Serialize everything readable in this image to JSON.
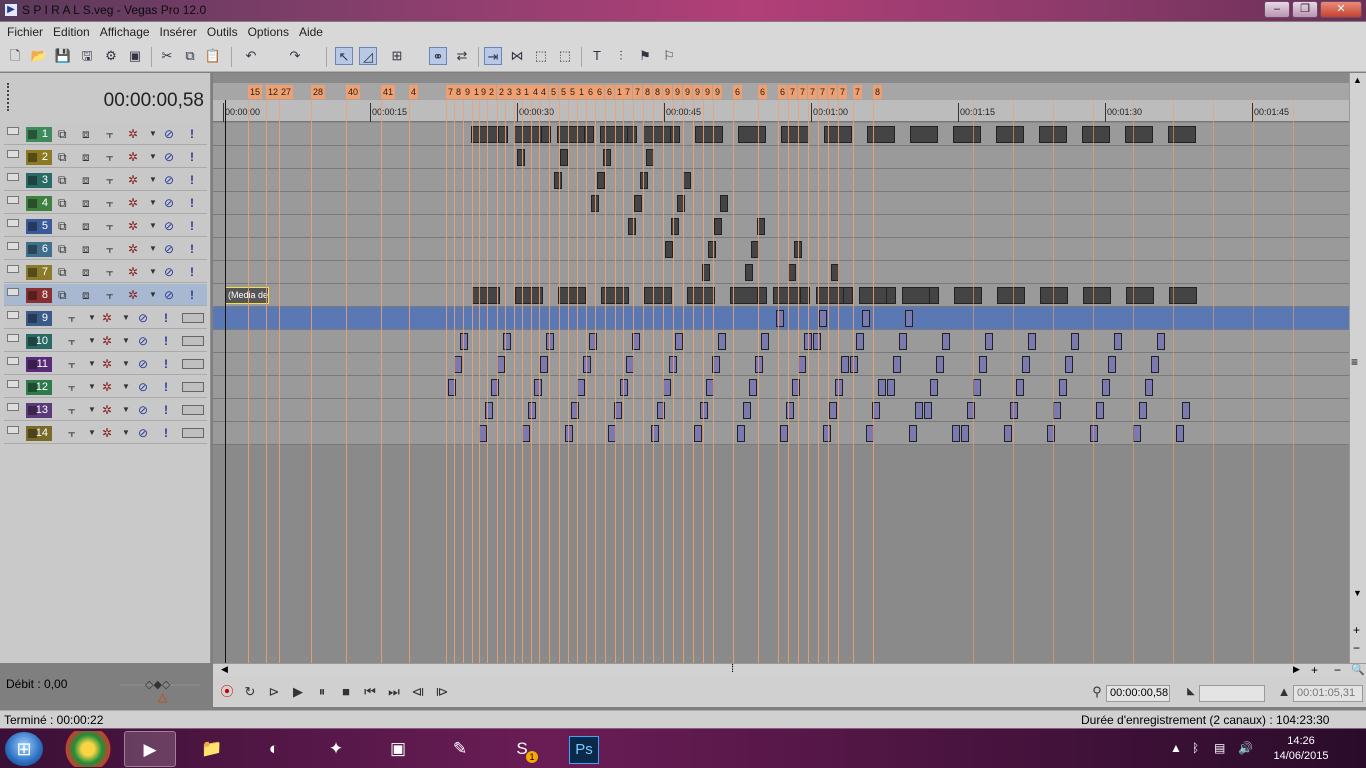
{
  "window": {
    "title": "S P I R A L S.veg - Vegas Pro 12.0",
    "app_icon": "vegas-icon"
  },
  "menu": [
    "Fichier",
    "Edition",
    "Affichage",
    "Insérer",
    "Outils",
    "Options",
    "Aide"
  ],
  "timecode": "00:00:00,58",
  "tracks": [
    {
      "number": "1",
      "kind": "video",
      "color": "#3f8a5a"
    },
    {
      "number": "2",
      "kind": "video",
      "color": "#8c7a22"
    },
    {
      "number": "3",
      "kind": "video",
      "color": "#2a6a64"
    },
    {
      "number": "4",
      "kind": "video",
      "color": "#3f7f3f"
    },
    {
      "number": "5",
      "kind": "video",
      "color": "#3a5a9a"
    },
    {
      "number": "6",
      "kind": "video",
      "color": "#3f6f8a"
    },
    {
      "number": "7",
      "kind": "video",
      "color": "#8a7a2a"
    },
    {
      "number": "8",
      "kind": "video",
      "color": "#8a2f2f",
      "selected": true
    },
    {
      "number": "9",
      "kind": "audio",
      "color": "#3a5a8a"
    },
    {
      "number": "10",
      "kind": "audio",
      "color": "#2a6a64"
    },
    {
      "number": "11",
      "kind": "audio",
      "color": "#5a2a7a"
    },
    {
      "number": "12",
      "kind": "audio",
      "color": "#2f7a4a"
    },
    {
      "number": "13",
      "kind": "audio",
      "color": "#5a3a7a"
    },
    {
      "number": "14",
      "kind": "audio",
      "color": "#7a6a2a"
    }
  ],
  "ruler": {
    "labels": [
      "00:00:00",
      "00:00:15",
      "00:00:30",
      "00:00:45",
      "00:01:00",
      "00:01:15",
      "00:01:30",
      "00:01:45"
    ]
  },
  "markers": [
    "15",
    "12",
    "27",
    "28",
    "40",
    "41",
    "4",
    "7",
    "8",
    "9",
    "1",
    "9",
    "2",
    "2",
    "3",
    "3",
    "1",
    "4",
    "4",
    "5",
    "5",
    "5",
    "1",
    "6",
    "6",
    "6",
    "1",
    "7",
    "7",
    "8",
    "8",
    "9",
    "9",
    "9",
    "9",
    "9",
    "9",
    "6",
    "6",
    "6",
    "7",
    "7",
    "7",
    "7",
    "7",
    "7",
    "7",
    "8"
  ],
  "clip_label": "(Media de",
  "debit": "Débit : 0,00",
  "transport": {
    "cursor_time": "00:00:00,58",
    "end_time": "00:01:05,31"
  },
  "status": {
    "left": "Terminé : 00:00:22",
    "right": "Durée d'enregistrement (2 canaux) : 104:23:30"
  },
  "taskbar": {
    "apps": [
      "chrome-icon",
      "vegas-icon",
      "explorer-icon",
      "app-icon",
      "game-icon",
      "media-icon",
      "editor-icon",
      "skype-icon",
      "photoshop-icon"
    ],
    "ps_label": "Ps",
    "skype_badge": "1"
  },
  "clock": {
    "time": "14:26",
    "date": "14/06/2015"
  },
  "colors": {
    "marker": "#f0a070",
    "selection_line": "#e08a50",
    "video_lane": "#9a9a9a",
    "audio_band": "#5a78b4"
  }
}
